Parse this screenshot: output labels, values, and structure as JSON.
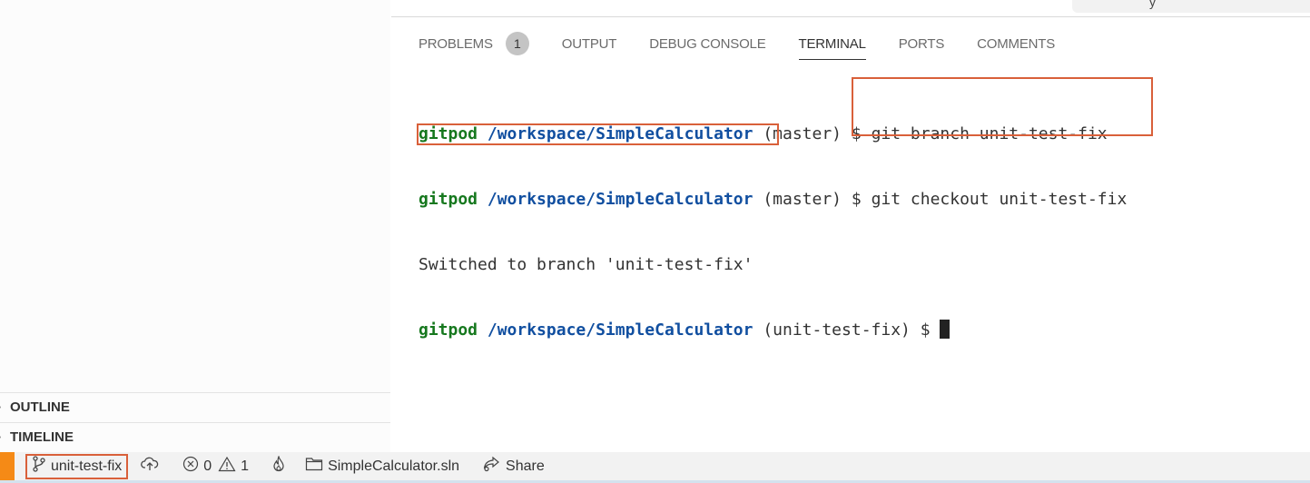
{
  "sidebar": {
    "sections": [
      {
        "label": "OUTLINE",
        "collapsed": true
      },
      {
        "label": "TIMELINE",
        "collapsed": true
      }
    ]
  },
  "panel": {
    "tabs": [
      {
        "label": "PROBLEMS",
        "badge": "1",
        "active": false
      },
      {
        "label": "OUTPUT",
        "active": false
      },
      {
        "label": "DEBUG CONSOLE",
        "active": false
      },
      {
        "label": "TERMINAL",
        "active": true
      },
      {
        "label": "PORTS",
        "active": false
      },
      {
        "label": "COMMENTS",
        "active": false
      }
    ]
  },
  "terminal": {
    "lines": [
      {
        "user": "gitpod",
        "path": "/workspace/SimpleCalculator",
        "branch": "(master)",
        "prompt": "$",
        "command": "git branch unit-test-fix"
      },
      {
        "user": "gitpod",
        "path": "/workspace/SimpleCalculator",
        "branch": "(master)",
        "prompt": "$",
        "command": "git checkout unit-test-fix"
      },
      {
        "output": "Switched to branch 'unit-test-fix'"
      },
      {
        "user": "gitpod",
        "path": "/workspace/SimpleCalculator",
        "branch": "(unit-test-fix)",
        "prompt": "$",
        "command": ""
      }
    ]
  },
  "statusbar": {
    "branch": "unit-test-fix",
    "errors": "0",
    "warnings": "1",
    "solution": "SimpleCalculator.sln",
    "share": "Share",
    "icons": {
      "branch": "git-branch-icon",
      "publish": "cloud-upload-icon",
      "errors": "error-circle-icon",
      "warnings": "warning-triangle-icon",
      "flame": "flame-icon",
      "folder": "folder-icon",
      "share": "live-share-icon"
    }
  },
  "colors": {
    "highlight": "#d9603a",
    "remote_indicator": "#f58a16",
    "prompt_user": "#16781e",
    "prompt_path": "#114fa0"
  }
}
